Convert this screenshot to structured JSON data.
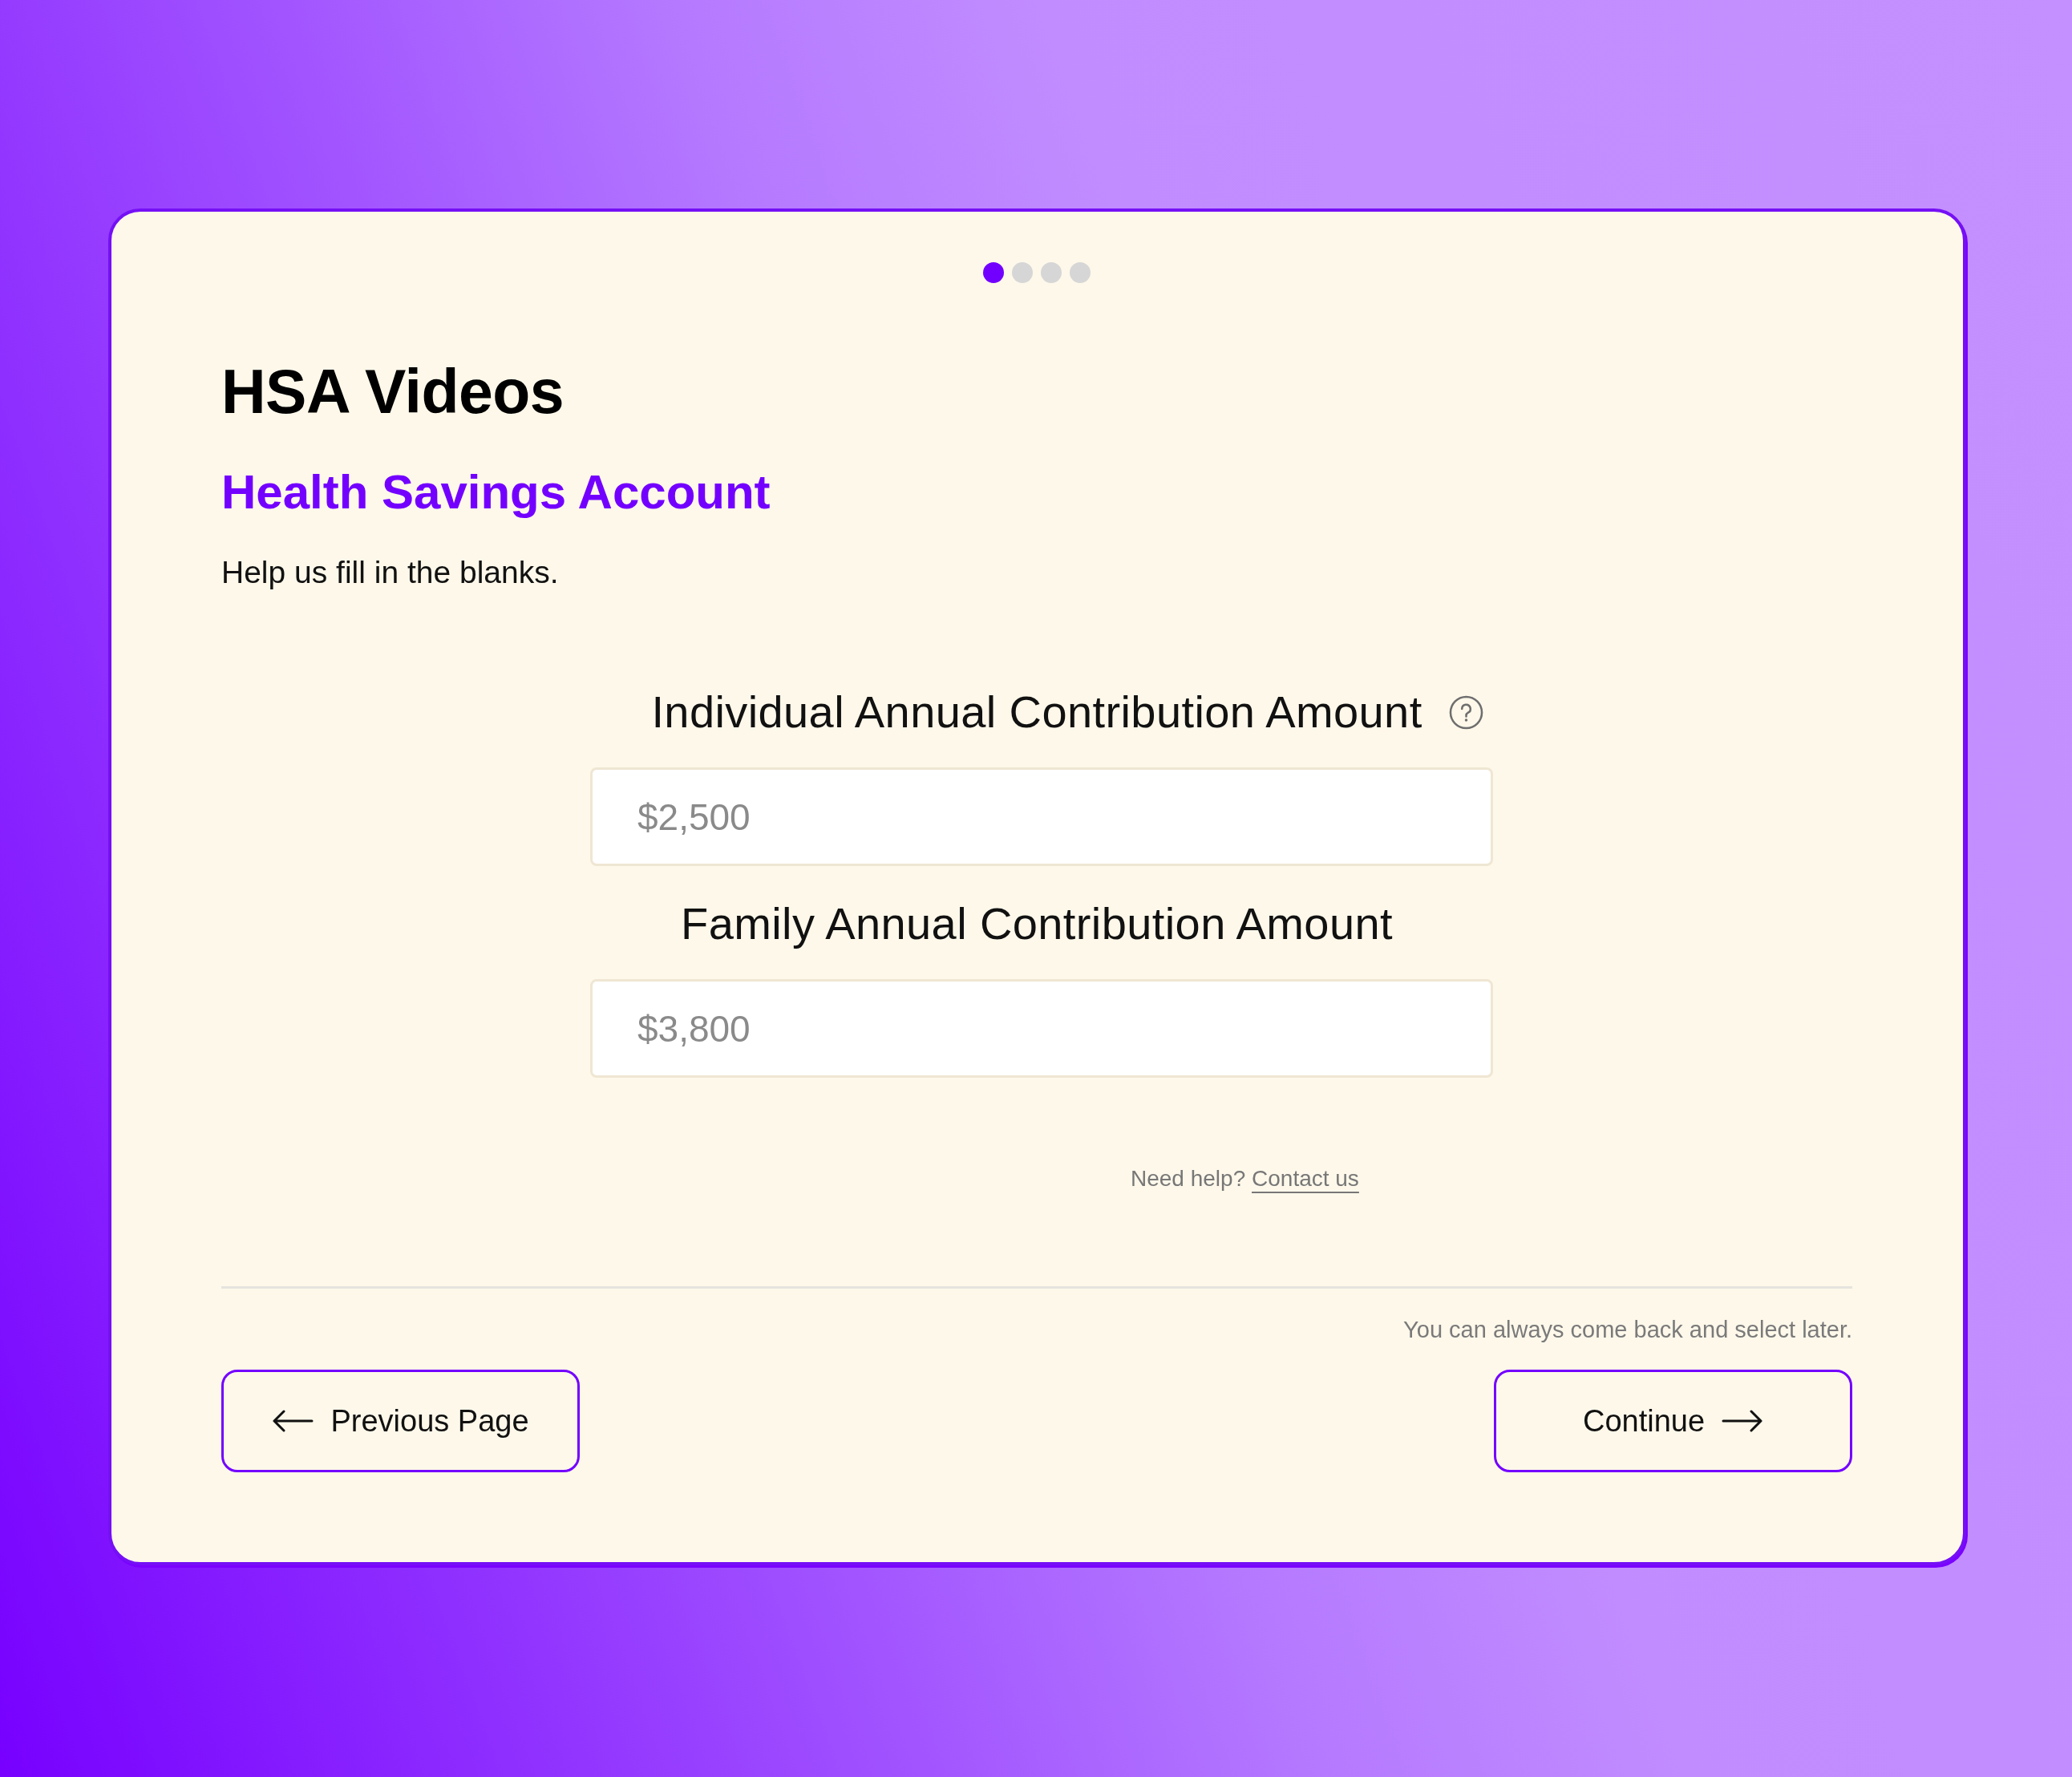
{
  "progress": {
    "steps": [
      {
        "selected": true
      },
      {
        "selected": false
      },
      {
        "selected": false
      },
      {
        "selected": false
      }
    ]
  },
  "title": "HSA Videos",
  "subtitle": "Health Savings Account",
  "intro": "Help us fill in the blanks.",
  "fields": [
    {
      "label": "Individual Annual Contribution Amount",
      "placeholder": "$2,500",
      "help_icon": true
    },
    {
      "label": "Family Annual Contribution Amount",
      "placeholder": "$3,800",
      "help_icon": false
    }
  ],
  "help": {
    "text": "Need help?",
    "link": "Contact us"
  },
  "footer_note": "You can always come back and select later.",
  "buttons": [
    {
      "label": "Previous Page",
      "kind": "back"
    },
    {
      "label": "Continue",
      "kind": "next"
    }
  ]
}
